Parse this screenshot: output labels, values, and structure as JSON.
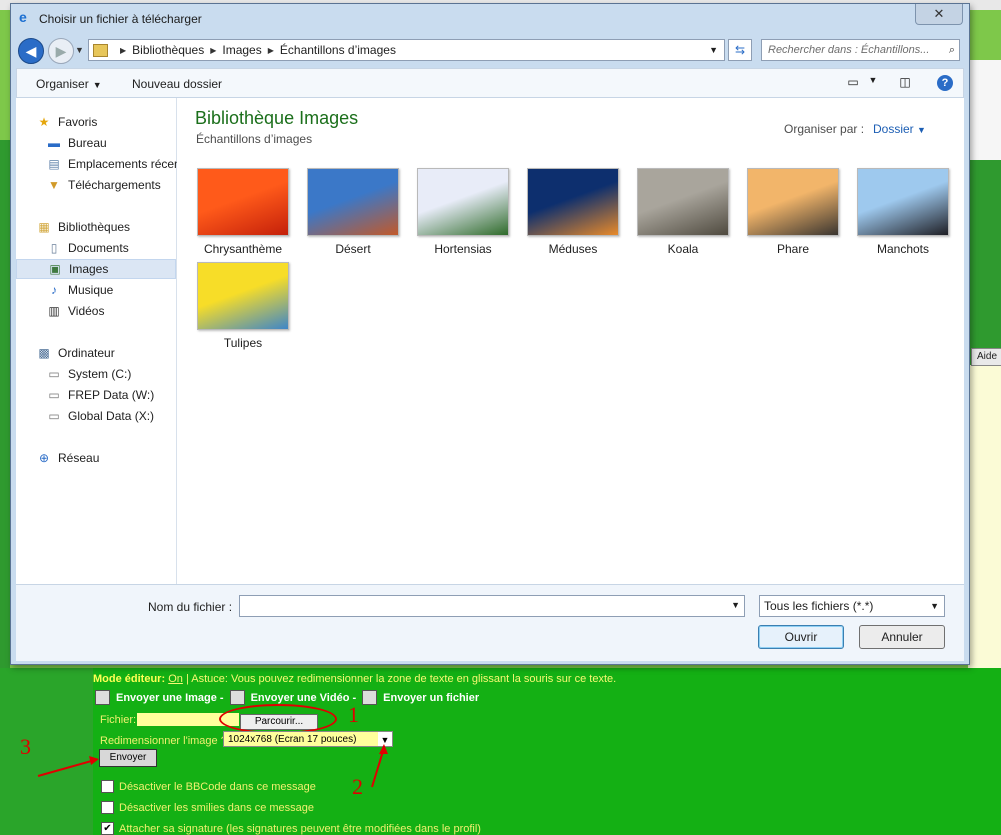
{
  "dialog": {
    "title": "Choisir un fichier à télécharger",
    "close_label": "✕",
    "address": {
      "crumbs": [
        "Bibliothèques",
        "Images",
        "Échantillons d’images"
      ],
      "search_placeholder": "Rechercher dans : Échantillons..."
    },
    "toolbar": {
      "organize": "Organiser",
      "new_folder": "Nouveau dossier"
    },
    "nav": {
      "favorites": "Favoris",
      "desktop": "Bureau",
      "recent_places": "Emplacements récents",
      "downloads": "Téléchargements",
      "libraries": "Bibliothèques",
      "documents": "Documents",
      "images": "Images",
      "music": "Musique",
      "videos": "Vidéos",
      "computer": "Ordinateur",
      "drive_c": "System (C:)",
      "drive_w": "FREP Data (W:)",
      "drive_x": "Global Data (X:)",
      "network": "Réseau"
    },
    "library": {
      "title": "Bibliothèque Images",
      "subtitle": "Échantillons d’images",
      "arrange_label": "Organiser par :",
      "arrange_value": "Dossier"
    },
    "files": [
      {
        "name": "Chrysanthème",
        "colors": [
          "#ff5a1a",
          "#c4200a"
        ]
      },
      {
        "name": "Désert",
        "colors": [
          "#3b78c8",
          "#c2592a"
        ]
      },
      {
        "name": "Hortensias",
        "colors": [
          "#e8ecf8",
          "#2f6b2a"
        ]
      },
      {
        "name": "Méduses",
        "colors": [
          "#0d2f6e",
          "#e88a2a"
        ]
      },
      {
        "name": "Koala",
        "colors": [
          "#a9a59c",
          "#4f4a3f"
        ]
      },
      {
        "name": "Phare",
        "colors": [
          "#f2b56a",
          "#3a3530"
        ]
      },
      {
        "name": "Manchots",
        "colors": [
          "#9ec9ee",
          "#1f1f25"
        ]
      },
      {
        "name": "Tulipes",
        "colors": [
          "#f7dd28",
          "#3f86c8"
        ]
      }
    ],
    "footer": {
      "filename_label": "Nom du fichier :",
      "filename_value": "",
      "filetype_value": "Tous les fichiers (*.*)",
      "open": "Ouvrir",
      "cancel": "Annuler"
    }
  },
  "forum": {
    "aide": "Aide",
    "editor_mode_label": "Mode éditeur:",
    "editor_mode_value": "On",
    "editor_tip": "| Astuce: Vous pouvez redimensionner la zone de texte en glissant la souris sur ce texte.",
    "send_image": "Envoyer une Image -",
    "send_video": "Envoyer une Vidéo -",
    "send_file": "Envoyer un fichier",
    "file_label": "Fichier:",
    "browse": "Parcourir...",
    "resize_label": "Redimensionner l'image ?",
    "resize_value": "1024x768 (Ecran 17 pouces)",
    "send_button": "Envoyer",
    "options": [
      {
        "label": "Désactiver le BBCode dans ce message",
        "checked": false
      },
      {
        "label": "Désactiver les smilies dans ce message",
        "checked": false
      },
      {
        "label": "Attacher sa signature (les signatures peuvent être modifiées dans le profil)",
        "checked": true
      }
    ],
    "annotations": [
      "1",
      "2",
      "3"
    ]
  }
}
